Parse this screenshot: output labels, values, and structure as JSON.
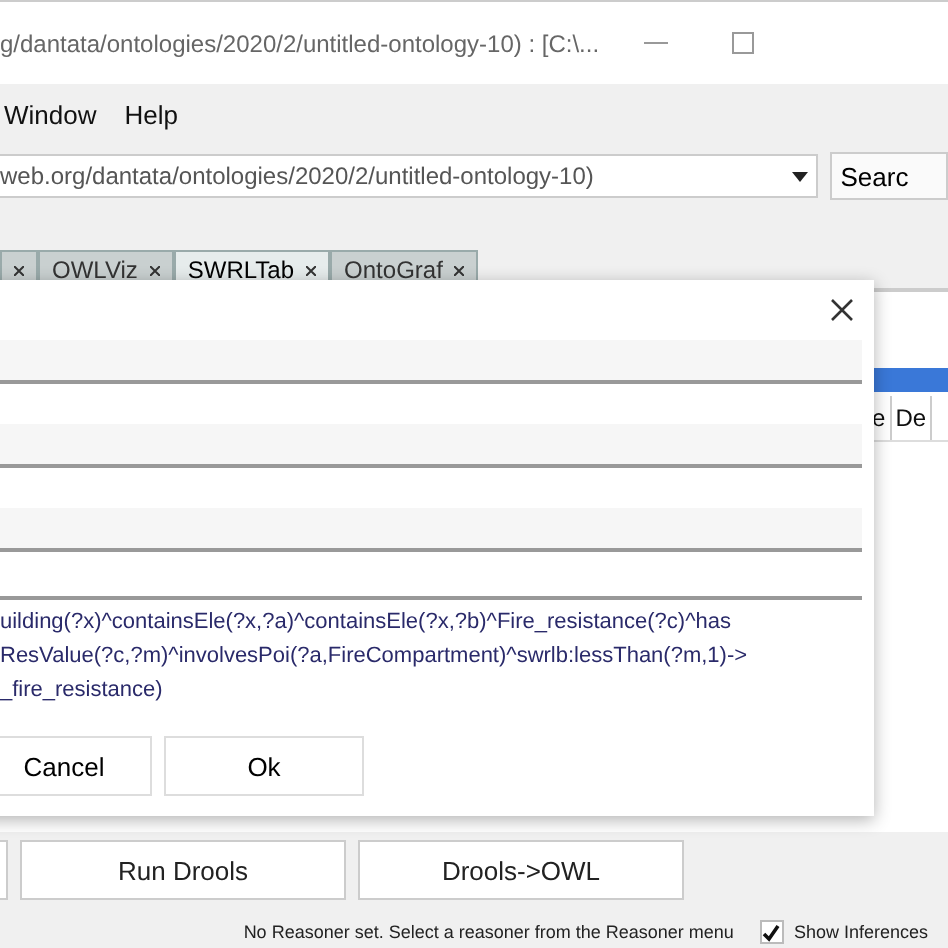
{
  "window": {
    "title": "g/dantata/ontologies/2020/2/untitled-ontology-10)  : [C:\\..."
  },
  "menu": [
    "Window",
    "Help"
  ],
  "address": {
    "value": "web.org/dantata/ontologies/2020/2/untitled-ontology-10)",
    "search_button": "Searc"
  },
  "tabs": [
    {
      "selected": false
    },
    {
      "label": "OWLViz",
      "selected": false
    },
    {
      "label": "SWRLTab",
      "selected": true
    },
    {
      "label": "OntoGraf",
      "selected": false
    }
  ],
  "table": {
    "columns": [
      "e",
      "De"
    ]
  },
  "dialog": {
    "fields": [
      {
        "kind": "shaded"
      },
      {
        "kind": "shaded"
      },
      {
        "kind": "shaded"
      },
      {
        "kind": "plain"
      }
    ],
    "rule": "uilding(?x)^containsEle(?x,?a)^containsEle(?x,?b)^Fire_resistance(?c)^has\nResValue(?c,?m)^involvesPoi(?a,FireCompartment)^swrlb:lessThan(?m,1)->\n_fire_resistance)",
    "buttons": [
      "Cancel",
      "Ok"
    ]
  },
  "actions": [
    "Run Drools",
    "Drools->OWL"
  ],
  "status": {
    "message": "No Reasoner set. Select a reasoner from the Reasoner menu",
    "show_inferences": {
      "label": "Show Inferences",
      "checked": true
    }
  }
}
